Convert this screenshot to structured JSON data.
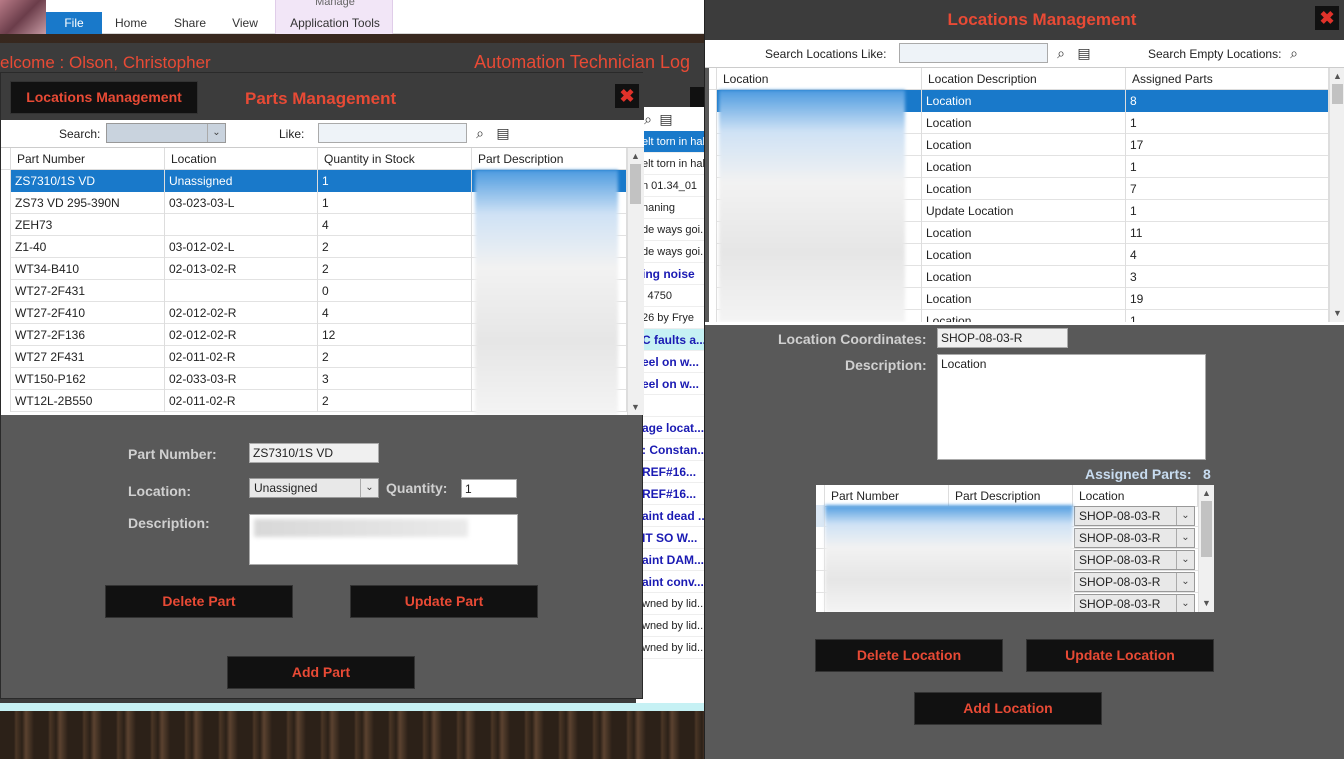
{
  "explorer": {
    "tabs": [
      "File",
      "Home",
      "Share",
      "View"
    ],
    "context_group": "Manage",
    "context_tab": "Application Tools"
  },
  "techlog": {
    "welcome": "elcome :  Olson, Christopher",
    "title": "Automation Technician Log",
    "list": [
      {
        "text": "elt torn in hal...",
        "style": "hl"
      },
      {
        "text": "elt torn in hal...",
        "style": "n"
      },
      {
        "text": "n 01.34_01",
        "style": "n"
      },
      {
        "text": "naning",
        "style": "n"
      },
      {
        "text": "de ways goi...",
        "style": "n"
      },
      {
        "text": "de ways goi...",
        "style": "n"
      },
      {
        "text": "ing noise",
        "style": "bl"
      },
      {
        "text": "l 4750",
        "style": "n"
      },
      {
        "text": "26 by Frye",
        "style": "n"
      },
      {
        "text": "C faults a...",
        "style": "cy"
      },
      {
        "text": "eel on w...",
        "style": "bl"
      },
      {
        "text": "eel on w...",
        "style": "bl"
      },
      {
        "text": "",
        "style": "n"
      },
      {
        "text": "age locat...",
        "style": "bl"
      },
      {
        "text": ": Constan...",
        "style": "bl"
      },
      {
        "text": "REF#16...",
        "style": "bl"
      },
      {
        "text": "REF#16...",
        "style": "bl"
      },
      {
        "text": "aint dead ...",
        "style": "bl"
      },
      {
        "text": "IT SO W...",
        "style": "bl"
      },
      {
        "text": "aint DAM...",
        "style": "bl"
      },
      {
        "text": "aint conv...",
        "style": "bl"
      },
      {
        "text": "wned by lid...",
        "style": "n"
      },
      {
        "text": "wned by lid...",
        "style": "n"
      },
      {
        "text": "wned by lid...",
        "style": "n"
      }
    ]
  },
  "parts": {
    "locations_button": "Locations Management",
    "title": "Parts Management",
    "close": "✖",
    "search_label": "Search:",
    "like_label": "Like:",
    "columns": [
      "Part Number",
      "Location",
      "Quantity in Stock",
      "Part Description"
    ],
    "rows": [
      [
        "ZS7310/1S VD",
        "Unassigned",
        "1"
      ],
      [
        "ZS73 VD 295-390N",
        "03-023-03-L",
        "1"
      ],
      [
        "ZEH73",
        "",
        "4"
      ],
      [
        "Z1-40",
        "03-012-02-L",
        "2"
      ],
      [
        "WT34-B410",
        "02-013-02-R",
        "2"
      ],
      [
        "WT27-2F431",
        "",
        "0"
      ],
      [
        "WT27-2F410",
        "02-012-02-R",
        "4"
      ],
      [
        "WT27-2F136",
        "02-012-02-R",
        "12"
      ],
      [
        "WT27 2F431",
        "02-011-02-R",
        "2"
      ],
      [
        "WT150-P162",
        "02-033-03-R",
        "3"
      ],
      [
        "WT12L-2B550",
        "02-011-02-R",
        "2"
      ]
    ],
    "selected_row": 0,
    "form": {
      "part_number_label": "Part Number:",
      "part_number_value": "ZS7310/1S VD",
      "location_label": "Location:",
      "location_value": "Unassigned",
      "quantity_label": "Quantity:",
      "quantity_value": "1",
      "description_label": "Description:"
    },
    "buttons": {
      "delete": "Delete Part",
      "update": "Update Part",
      "add": "Add Part"
    }
  },
  "locations": {
    "title": "Locations Management",
    "close": "✖",
    "search_like_label": "Search Locations Like:",
    "search_empty_label": "Search Empty Locations:",
    "columns": [
      "Location",
      "Location Description",
      "Assigned Parts"
    ],
    "rows": [
      [
        "Location",
        "8"
      ],
      [
        "Location",
        "1"
      ],
      [
        "Location",
        "17"
      ],
      [
        "Location",
        "1"
      ],
      [
        "Location",
        "7"
      ],
      [
        "Update Location",
        "1"
      ],
      [
        "Location",
        "11"
      ],
      [
        "Location",
        "4"
      ],
      [
        "Location",
        "3"
      ],
      [
        "Location",
        "19"
      ],
      [
        "Location",
        "1"
      ]
    ],
    "selected_row": 0,
    "form": {
      "coords_label": "Location Coordinates:",
      "coords_value": "SHOP-08-03-R",
      "description_label": "Description:",
      "description_value": "Location",
      "assigned_label": "Assigned Parts:",
      "assigned_count": "8"
    },
    "sub_columns": [
      "Part Number",
      "Part Description",
      "Location"
    ],
    "sub_rows": [
      "SHOP-08-03-R",
      "SHOP-08-03-R",
      "SHOP-08-03-R",
      "SHOP-08-03-R",
      "SHOP-08-03-R"
    ],
    "buttons": {
      "delete": "Delete Location",
      "update": "Update Location",
      "add": "Add Location"
    }
  },
  "colors": {
    "accent": "#e84a35",
    "selection": "#1979ca",
    "window_bg": "#595959"
  }
}
